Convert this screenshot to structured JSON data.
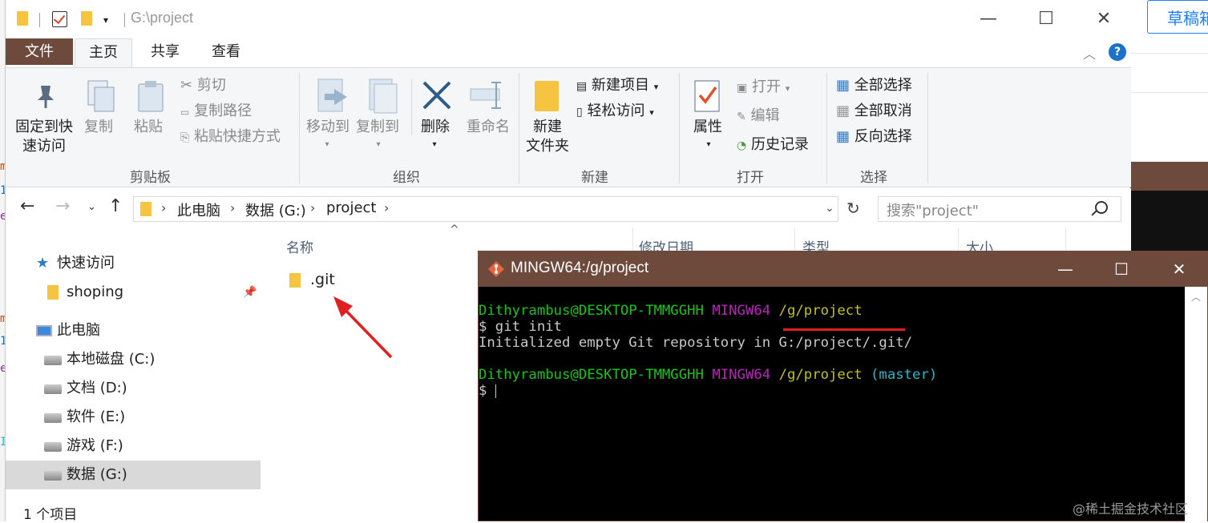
{
  "background": {
    "button_label": "草稿箱",
    "left_glyphs": [
      "m",
      "1",
      "e",
      "m",
      "1",
      "e",
      "I"
    ]
  },
  "window": {
    "title": "G:\\project"
  },
  "ribbon_tabs": [
    "文件",
    "主页",
    "共享",
    "查看"
  ],
  "help": "?",
  "ribbon": {
    "clipboard": {
      "group": "剪贴板",
      "pin": "固定到快\n速访问",
      "copy": "复制",
      "paste": "粘贴",
      "cut": "剪切",
      "copy_path": "复制路径",
      "paste_shortcut": "粘贴快捷方式"
    },
    "organize": {
      "group": "组织",
      "move_to": "移动到",
      "copy_to": "复制到",
      "delete": "删除",
      "rename": "重命名"
    },
    "new": {
      "group": "新建",
      "new_folder": "新建\n文件夹",
      "new_item": "新建项目",
      "easy_access": "轻松访问"
    },
    "open": {
      "group": "打开",
      "properties": "属性",
      "open": "打开",
      "edit": "编辑",
      "history": "历史记录"
    },
    "select": {
      "group": "选择",
      "select_all": "全部选择",
      "select_none": "全部取消",
      "invert": "反向选择"
    }
  },
  "address": {
    "crumbs": [
      "此电脑",
      "数据 (G:)",
      "project"
    ],
    "search_placeholder": "搜索\"project\""
  },
  "nav": {
    "quick_access": "快速访问",
    "shoping": "shoping",
    "this_pc": "此电脑",
    "drives": [
      "本地磁盘 (C:)",
      "文档 (D:)",
      "软件 (E:)",
      "游戏 (F:)",
      "数据 (G:)"
    ]
  },
  "status": "1 个项目",
  "columns": [
    "名称",
    "修改日期",
    "类型",
    "大小"
  ],
  "files": [
    ".git"
  ],
  "terminal": {
    "title": "MINGW64:/g/project",
    "user": "Dithyrambus@DESKTOP-TMMGGHH",
    "env": "MINGW64",
    "path": "/g/project",
    "branch": "(master)",
    "cmd": "$ git init",
    "output": "Initialized empty Git repository in G:/project/.git/",
    "prompt": "$ "
  },
  "watermark": "@稀土掘金技术社区",
  "colors": {
    "file_tab": "#6e4a3c",
    "accent": "#1e80ff",
    "arrow": "#e02020"
  }
}
